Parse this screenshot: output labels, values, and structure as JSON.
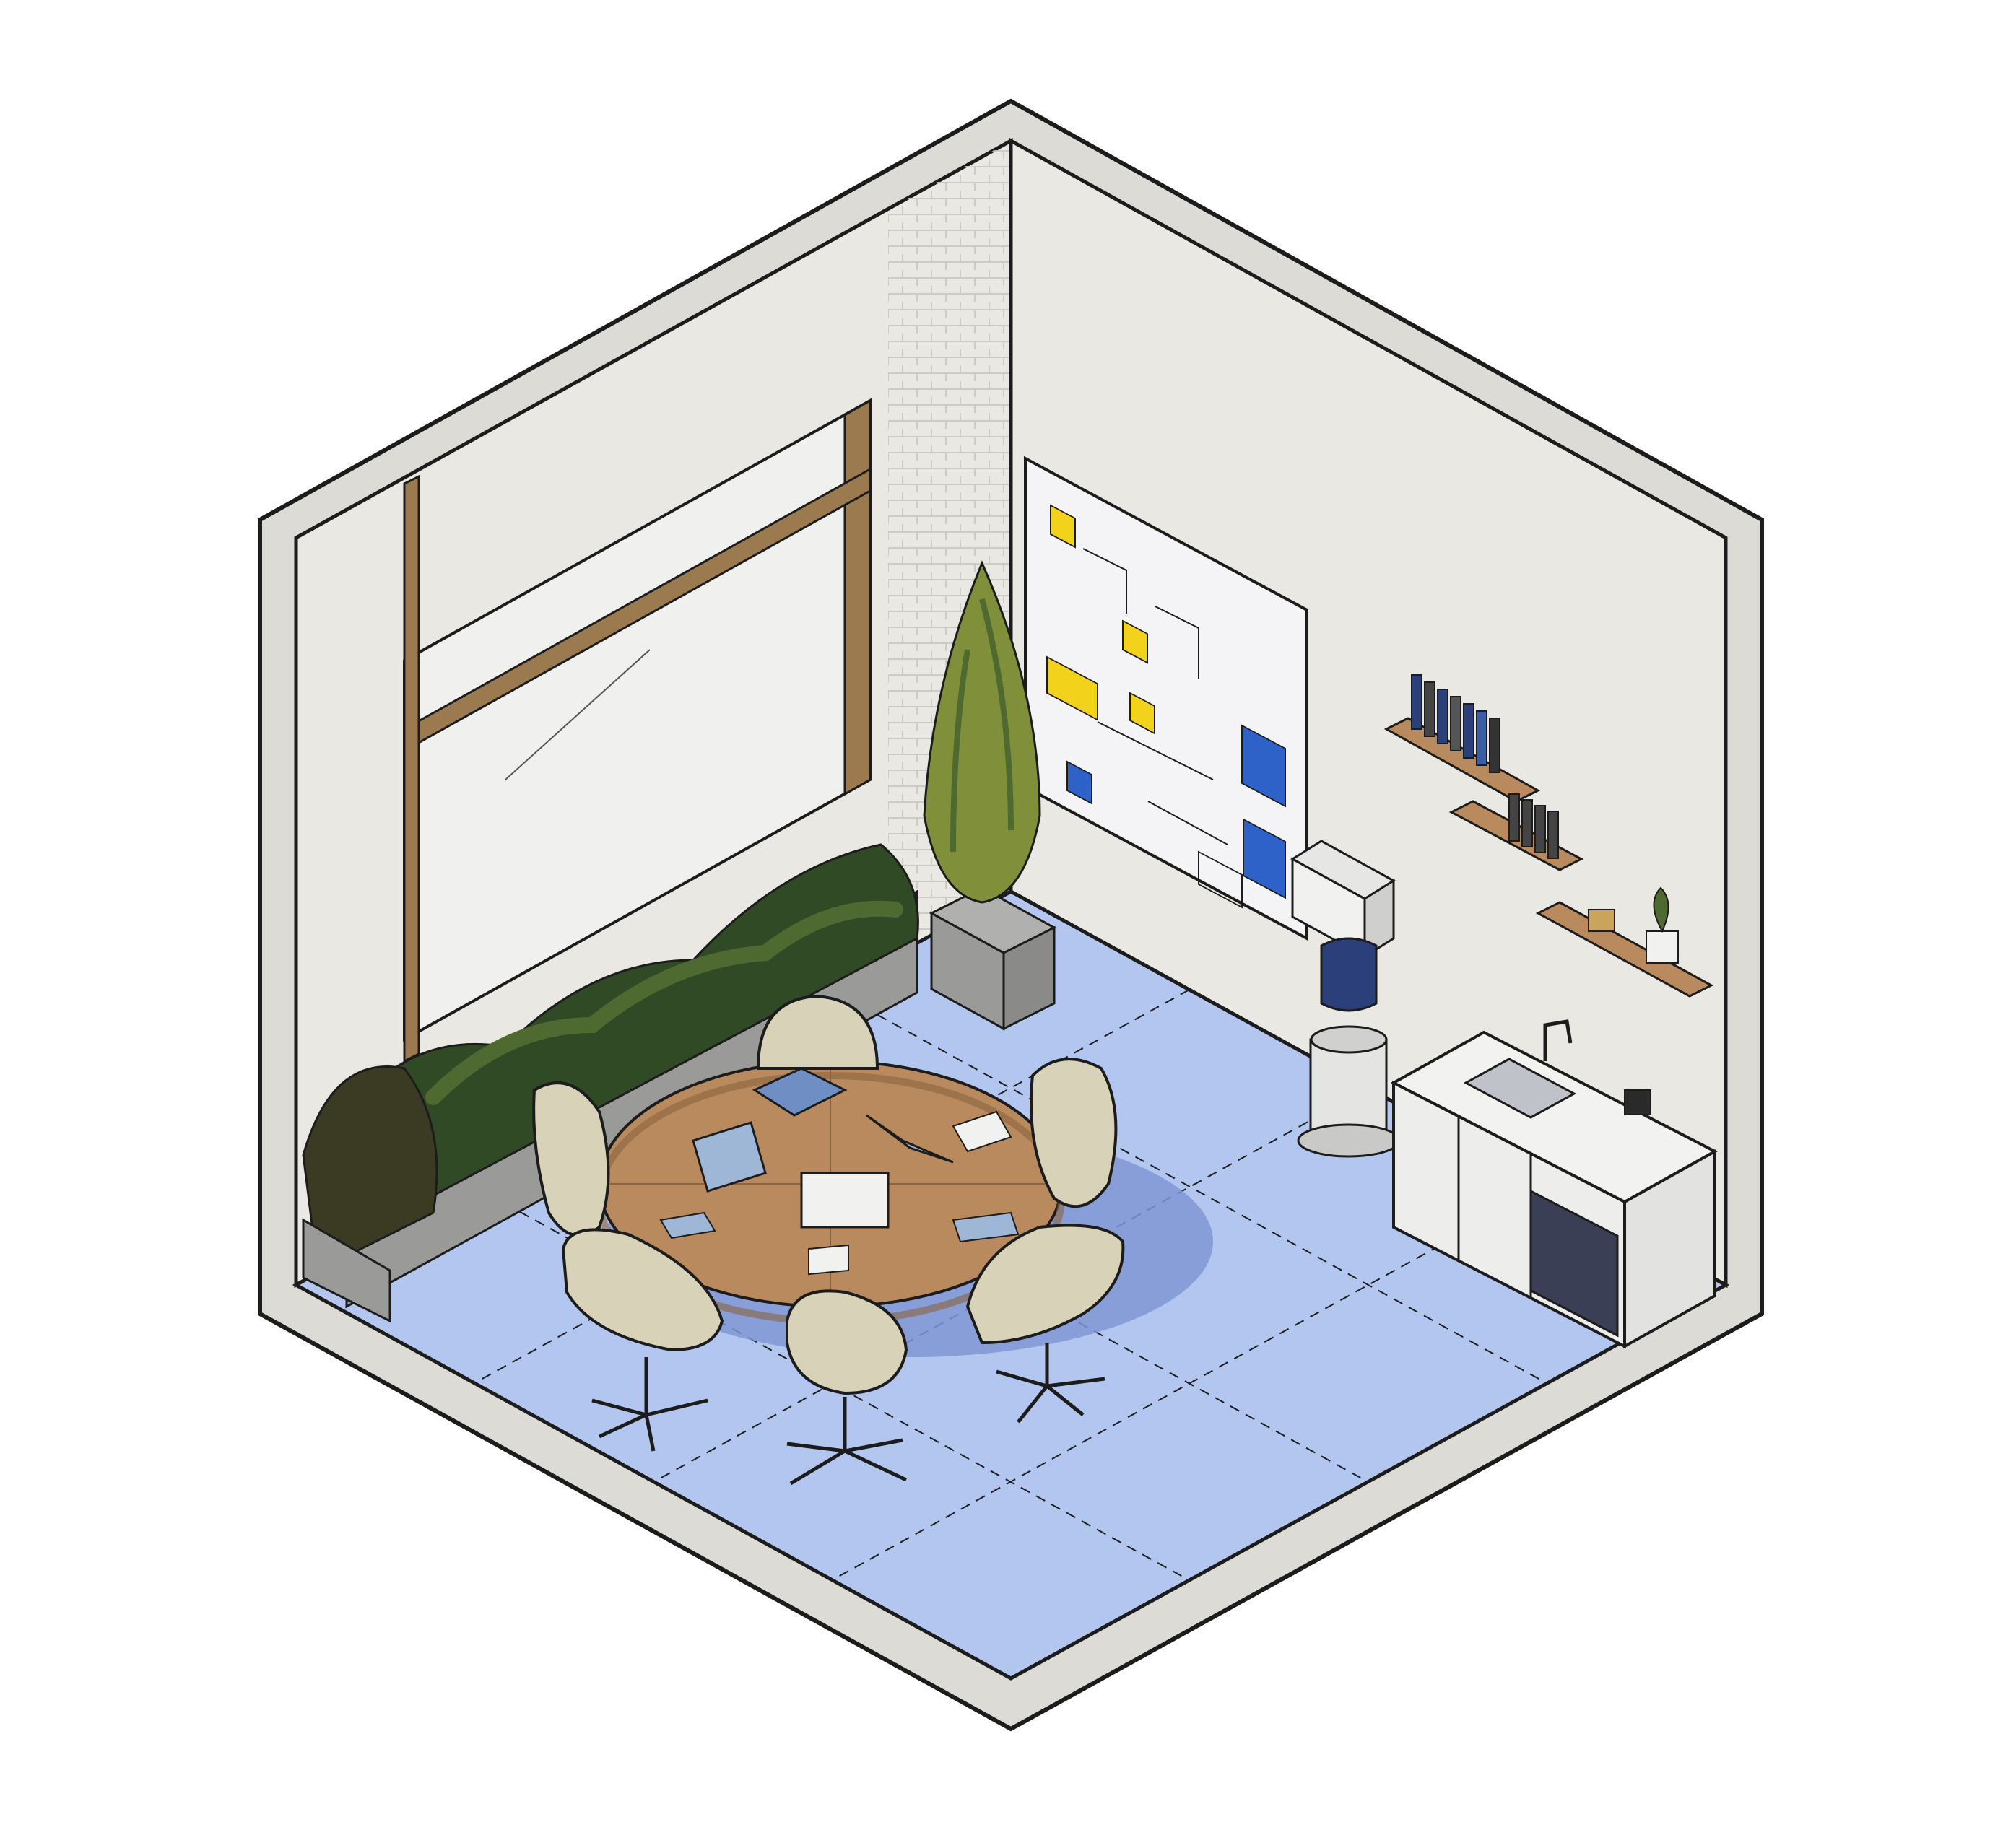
{
  "scene": {
    "kind": "isometric-room-illustration",
    "subject": "meeting room",
    "colors": {
      "background": "#ffffff",
      "wall": "#e9e8e3",
      "wall_shadow": "#d9d8d2",
      "wall_top": "#dcdbd5",
      "outline": "#1c1c1c",
      "floor": "#b3c6ef",
      "floor_shadow": "#7f96d4",
      "wood": "#b88a5e",
      "wood_dark": "#8a6440",
      "beam": "#9b7a4f",
      "chair": "#d8d2b8",
      "chair_shade": "#b9b294",
      "plant_dark": "#2f4a25",
      "plant_mid": "#4f6a30",
      "plant_light": "#7f8f3a",
      "sticky_yellow": "#f2d21b",
      "sticky_blue": "#2e62c9",
      "whiteboard": "#f4f4f7",
      "cabinet": "#f2f2f0",
      "planter": "#9a9a98"
    },
    "icons": [
      "wall-left-icon",
      "wall-right-icon",
      "floor-icon",
      "window-icon",
      "whiteboard-icon",
      "potted-plant-icon",
      "planter-box-icon",
      "round-table-icon",
      "office-chair-icon",
      "laptop-icon",
      "water-dispenser-icon",
      "wall-shelf-icon",
      "kitchenette-cabinet-icon",
      "sink-icon"
    ],
    "counts": {
      "chairs": 6,
      "wall_shelves": 3,
      "laptops": 3
    }
  }
}
